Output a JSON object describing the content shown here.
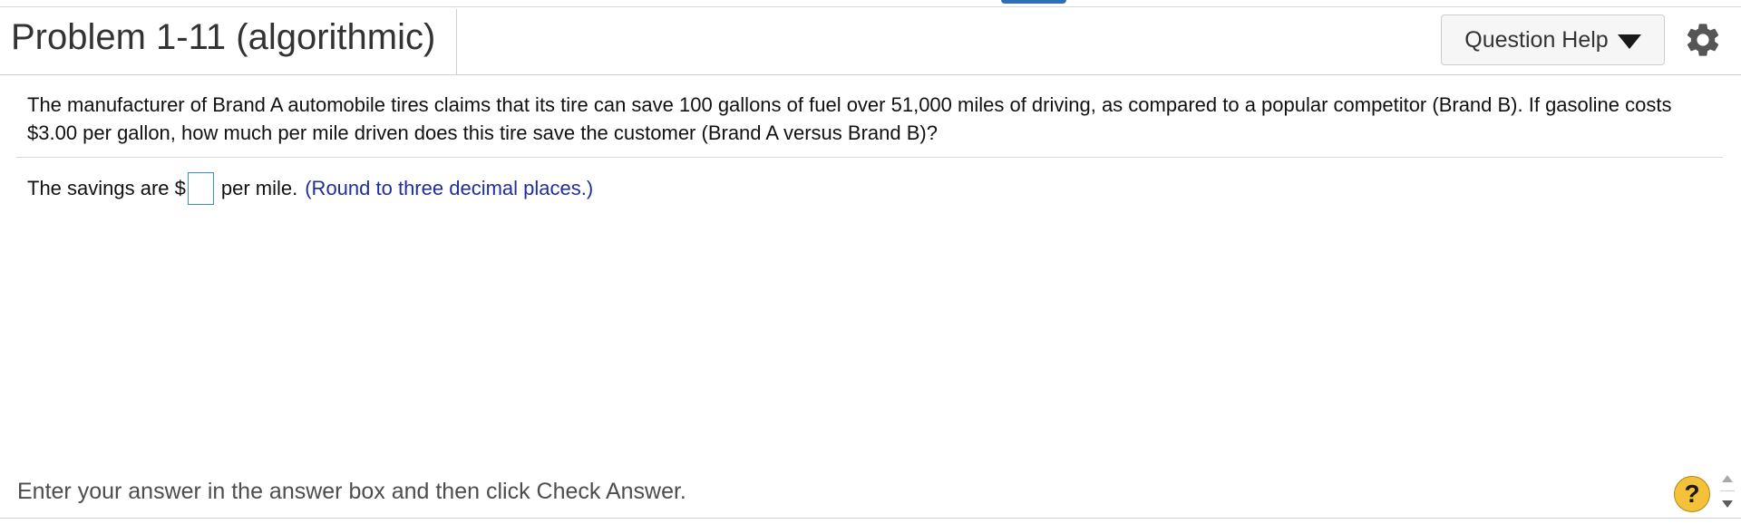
{
  "header": {
    "title": "Problem 1-11 (algorithmic)",
    "help_button_label": "Question Help"
  },
  "question": {
    "text": "The manufacturer of Brand A automobile tires claims that its tire can save 100 gallons of fuel over 51,000 miles of driving, as compared to a popular competitor (Brand B). If gasoline costs $3.00 per gallon, how much per mile driven does this tire save the customer (Brand A versus Brand B)?"
  },
  "answer": {
    "prefix": "The savings are $",
    "value": "",
    "suffix": "per mile.",
    "hint": "(Round to three decimal places.)"
  },
  "footer": {
    "instruction": "Enter your answer in the answer box and then click Check Answer.",
    "help_symbol": "?"
  },
  "icons": {
    "settings": "gear-icon",
    "dropdown": "caret-down-icon",
    "help": "question-mark-icon"
  },
  "colors": {
    "hint": "#1f2f9a",
    "answer_border": "#3a8fc7",
    "help_button": "#f4c13a"
  }
}
